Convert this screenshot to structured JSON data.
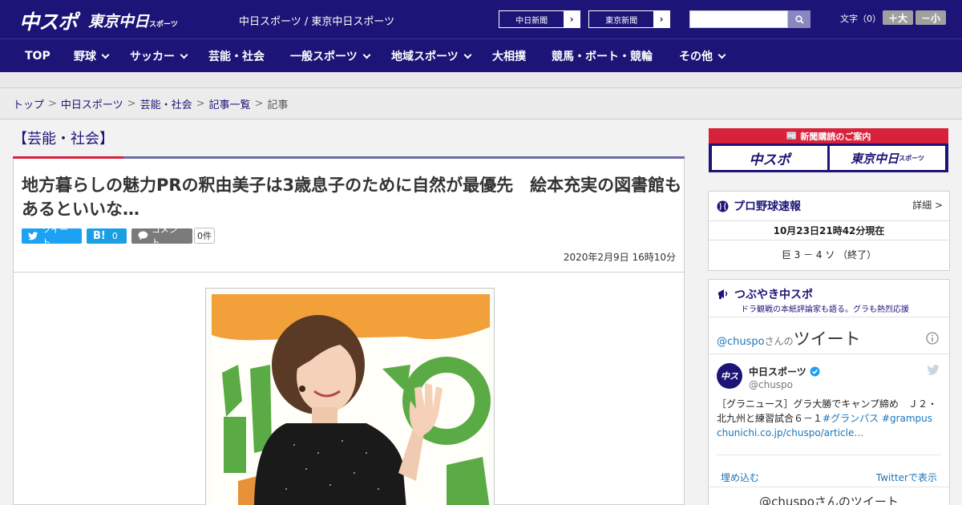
{
  "header": {
    "logo_main": "中スポ",
    "logo_tokyo": "東京中日",
    "logo_tokyo_sub": "スポーツ",
    "site_names": "中日スポーツ / 東京中日スポーツ",
    "ext_links": [
      "中日新聞",
      "東京新聞"
    ],
    "fontsize_label": "文字（0）",
    "fontsize_plus": "＋大",
    "fontsize_minus": "－小"
  },
  "nav": [
    {
      "label": "TOP",
      "dropdown": false
    },
    {
      "label": "野球",
      "dropdown": true
    },
    {
      "label": "サッカー",
      "dropdown": true
    },
    {
      "label": "芸能・社会",
      "dropdown": false
    },
    {
      "label": "一般スポーツ",
      "dropdown": true
    },
    {
      "label": "地域スポーツ",
      "dropdown": true
    },
    {
      "label": "大相撲",
      "dropdown": false
    },
    {
      "label": "競馬・ボート・競輪",
      "dropdown": false
    },
    {
      "label": "その他",
      "dropdown": true
    }
  ],
  "breadcrumb": [
    "トップ",
    "中日スポーツ",
    "芸能・社会",
    "記事一覧",
    "記事"
  ],
  "article": {
    "category": "【芸能・社会】",
    "headline": "地方暮らしの魅力PRの釈由美子は3歳息子のために自然が最優先　絵本充実の図書館もあるといいな…",
    "tweet_label": "ツイート",
    "hatena_label": "B!",
    "hatena_count": "0",
    "comment_label": "コメント",
    "comment_count": "0件",
    "date": "2020年2月9日 16時10分"
  },
  "sidebar": {
    "subscribe_label": "新聞購読のご案内",
    "subscribe_chuspo": "中スポ",
    "subscribe_tokyo": "東京中日",
    "subscribe_tokyo_sub": "スポーツ",
    "baseball": {
      "title": "プロ野球速報",
      "detail": "詳細 >",
      "updated": "10月23日21時42分現在",
      "score": "巨 3 － 4 ソ （終了）"
    },
    "tweets": {
      "title": "つぶやき中スポ",
      "subtitle": "ドラ観戦の本紙評論家も語る。グラも熱烈応援",
      "handle_prefix": "@chuspo",
      "handle_suffix": "さんの",
      "tweets_word": "ツイート",
      "account_name": "中日スポーツ",
      "account_handle": "@chuspo",
      "tweet_text": "［グラニュース］グラ大勝でキャンプ締め　Ｊ２・北九州と練習試合６－１",
      "tweet_tag1": "#グランパス",
      "tweet_tag2": "#grampus",
      "tweet_link": "chunichi.co.jp/chuspo/article…",
      "embed_label": "埋め込む",
      "view_on_twitter": "Twitterで表示",
      "footer_text": "@chuspoさんのツイート"
    }
  },
  "colors": {
    "brand_navy": "#1c1476",
    "accent_red": "#d8213a",
    "twitter_blue": "#1da1f2"
  }
}
